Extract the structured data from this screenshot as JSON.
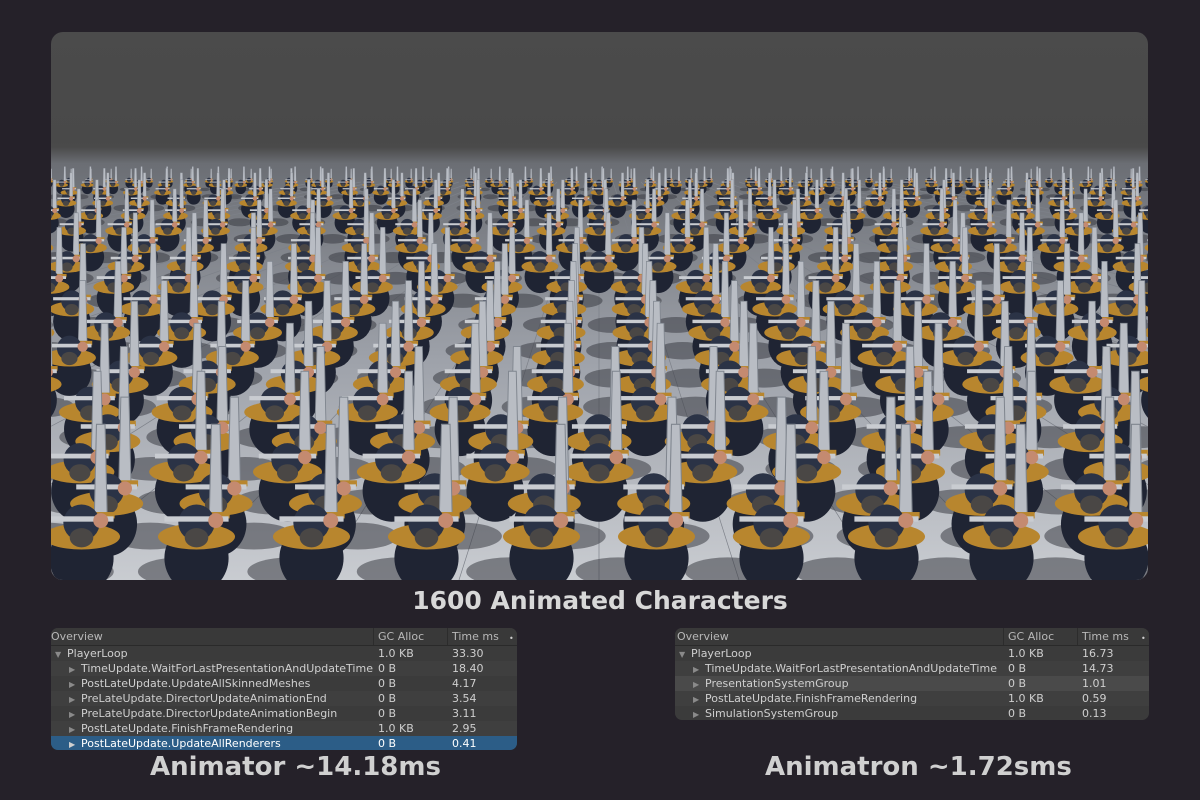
{
  "scene": {
    "title": "1600 Animated Characters"
  },
  "left_profiler": {
    "columns": {
      "name": "Overview",
      "gc": "GC Alloc",
      "time": "Time ms"
    },
    "rows": [
      {
        "name": "PlayerLoop",
        "gc": "1.0 KB",
        "time": "33.30",
        "level": 0,
        "expanded": true
      },
      {
        "name": "TimeUpdate.WaitForLastPresentationAndUpdateTime",
        "gc": "0 B",
        "time": "18.40",
        "level": 1
      },
      {
        "name": "PostLateUpdate.UpdateAllSkinnedMeshes",
        "gc": "0 B",
        "time": "4.17",
        "level": 1
      },
      {
        "name": "PreLateUpdate.DirectorUpdateAnimationEnd",
        "gc": "0 B",
        "time": "3.54",
        "level": 1
      },
      {
        "name": "PreLateUpdate.DirectorUpdateAnimationBegin",
        "gc": "0 B",
        "time": "3.11",
        "level": 1
      },
      {
        "name": "PostLateUpdate.FinishFrameRendering",
        "gc": "1.0 KB",
        "time": "2.95",
        "level": 1
      },
      {
        "name": "PostLateUpdate.UpdateAllRenderers",
        "gc": "0 B",
        "time": "0.41",
        "level": 1,
        "selected": true
      }
    ],
    "caption": "Animator ~14.18ms"
  },
  "right_profiler": {
    "columns": {
      "name": "Overview",
      "gc": "GC Alloc",
      "time": "Time ms"
    },
    "rows": [
      {
        "name": "PlayerLoop",
        "gc": "1.0 KB",
        "time": "16.73",
        "level": 0,
        "expanded": true
      },
      {
        "name": "TimeUpdate.WaitForLastPresentationAndUpdateTime",
        "gc": "0 B",
        "time": "14.73",
        "level": 1
      },
      {
        "name": "PresentationSystemGroup",
        "gc": "0 B",
        "time": "1.01",
        "level": 1,
        "highlight": true
      },
      {
        "name": "PostLateUpdate.FinishFrameRendering",
        "gc": "1.0 KB",
        "time": "0.59",
        "level": 1
      },
      {
        "name": "SimulationSystemGroup",
        "gc": "0 B",
        "time": "0.13",
        "level": 1
      }
    ],
    "caption": "Animatron ~1.72sms"
  },
  "colors": {
    "background": "#252129",
    "panel": "#3b3b3b",
    "selected_row": "#2c5d87",
    "character_armor": "#1f2433",
    "character_gold": "#b8862e",
    "sword": "#b9bdc4"
  }
}
